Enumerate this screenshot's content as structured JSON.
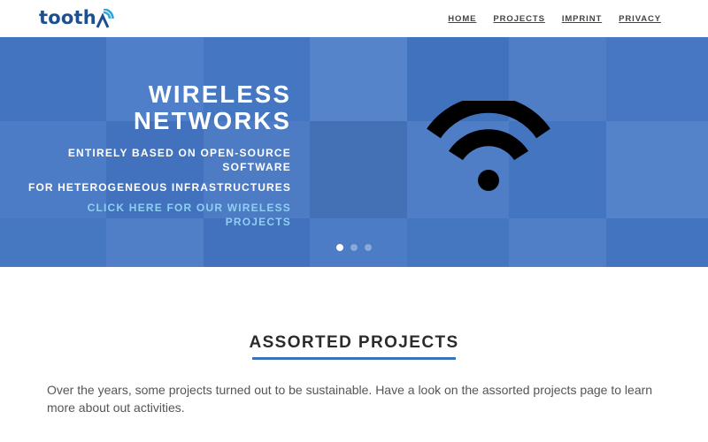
{
  "brand": {
    "name": "tooth",
    "logo_icon": "wifi-a-logo-icon",
    "color": "#1e4f8f"
  },
  "nav": {
    "items": [
      {
        "label": "HOME"
      },
      {
        "label": "PROJECTS"
      },
      {
        "label": "IMPRINT"
      },
      {
        "label": "PRIVACY"
      }
    ]
  },
  "hero": {
    "title_line1": "WIRELESS",
    "title_line2": "NETWORKS",
    "subtitle1": "ENTIRELY BASED ON OPEN-SOURCE SOFTWARE",
    "subtitle2": "FOR HETEROGENEOUS INFRASTRUCTURES",
    "link_text": "CLICK HERE FOR OUR WIRELESS PROJECTS",
    "icon": "wifi-icon",
    "slide_count": 3,
    "active_slide": 1,
    "overlay_color": "#4a78c0",
    "link_color": "#8fd0f2"
  },
  "section": {
    "title": "ASSORTED PROJECTS",
    "accent_color": "#3a73b8",
    "body": "Over the years, some projects turned out to be sustainable. Have a look on the assorted projects page to learn more about out activities."
  }
}
